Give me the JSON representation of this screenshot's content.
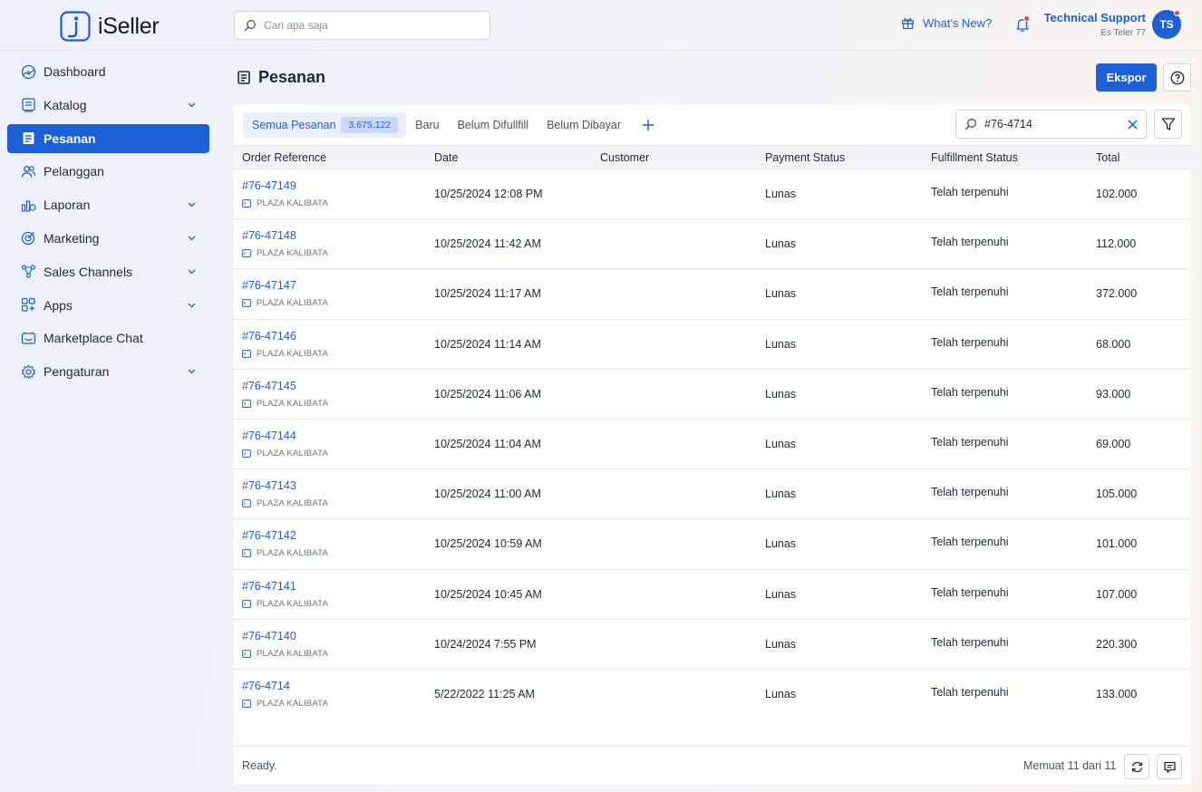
{
  "app": {
    "name": "iSeller"
  },
  "header": {
    "search_placeholder": "Cari apa saja",
    "whats_new": "What's New?",
    "user_name": "Technical Support",
    "user_store": "Es Teler 77",
    "avatar_initials": "TS"
  },
  "sidebar": {
    "items": [
      {
        "label": "Dashboard",
        "icon": "dashboard-icon",
        "has_children": false
      },
      {
        "label": "Katalog",
        "icon": "catalog-icon",
        "has_children": true
      },
      {
        "label": "Pesanan",
        "icon": "orders-icon",
        "has_children": false,
        "active": true
      },
      {
        "label": "Pelanggan",
        "icon": "customers-icon",
        "has_children": false
      },
      {
        "label": "Laporan",
        "icon": "reports-icon",
        "has_children": true
      },
      {
        "label": "Marketing",
        "icon": "target-icon",
        "has_children": true
      },
      {
        "label": "Sales Channels",
        "icon": "channels-icon",
        "has_children": true
      },
      {
        "label": "Apps",
        "icon": "apps-icon",
        "has_children": true
      },
      {
        "label": "Marketplace Chat",
        "icon": "chat-icon",
        "has_children": false
      },
      {
        "label": "Pengaturan",
        "icon": "gear-icon",
        "has_children": true
      }
    ]
  },
  "page": {
    "title": "Pesanan",
    "export_label": "Ekspor"
  },
  "tabs": [
    {
      "label": "Semua Pesanan",
      "badge": "3.675.122",
      "active": true
    },
    {
      "label": "Baru"
    },
    {
      "label": "Belum Difullfill"
    },
    {
      "label": "Belum Dibayar"
    }
  ],
  "order_search": {
    "value": "#76-4714"
  },
  "table": {
    "columns": [
      "Order Reference",
      "Date",
      "Customer",
      "Payment Status",
      "Fulfillment Status",
      "Total"
    ],
    "rows": [
      {
        "ref": "#76-47149",
        "store": "PLAZA KALIBATA",
        "date": "10/25/2024 12:08 PM",
        "customer": "",
        "payment": "Lunas",
        "fulfillment": "Telah terpenuhi",
        "total": "102.000"
      },
      {
        "ref": "#76-47148",
        "store": "PLAZA KALIBATA",
        "date": "10/25/2024 11:42 AM",
        "customer": "",
        "payment": "Lunas",
        "fulfillment": "Telah terpenuhi",
        "total": "112.000"
      },
      {
        "ref": "#76-47147",
        "store": "PLAZA KALIBATA",
        "date": "10/25/2024 11:17 AM",
        "customer": "",
        "payment": "Lunas",
        "fulfillment": "Telah terpenuhi",
        "total": "372.000"
      },
      {
        "ref": "#76-47146",
        "store": "PLAZA KALIBATA",
        "date": "10/25/2024 11:14 AM",
        "customer": "",
        "payment": "Lunas",
        "fulfillment": "Telah terpenuhi",
        "total": "68.000"
      },
      {
        "ref": "#76-47145",
        "store": "PLAZA KALIBATA",
        "date": "10/25/2024 11:06 AM",
        "customer": "",
        "payment": "Lunas",
        "fulfillment": "Telah terpenuhi",
        "total": "93.000"
      },
      {
        "ref": "#76-47144",
        "store": "PLAZA KALIBATA",
        "date": "10/25/2024 11:04 AM",
        "customer": "",
        "payment": "Lunas",
        "fulfillment": "Telah terpenuhi",
        "total": "69.000"
      },
      {
        "ref": "#76-47143",
        "store": "PLAZA KALIBATA",
        "date": "10/25/2024 11:00 AM",
        "customer": "",
        "payment": "Lunas",
        "fulfillment": "Telah terpenuhi",
        "total": "105.000"
      },
      {
        "ref": "#76-47142",
        "store": "PLAZA KALIBATA",
        "date": "10/25/2024 10:59 AM",
        "customer": "",
        "payment": "Lunas",
        "fulfillment": "Telah terpenuhi",
        "total": "101.000"
      },
      {
        "ref": "#76-47141",
        "store": "PLAZA KALIBATA",
        "date": "10/25/2024 10:45 AM",
        "customer": "",
        "payment": "Lunas",
        "fulfillment": "Telah terpenuhi",
        "total": "107.000"
      },
      {
        "ref": "#76-47140",
        "store": "PLAZA KALIBATA",
        "date": "10/24/2024 7:55 PM",
        "customer": "",
        "payment": "Lunas",
        "fulfillment": "Telah terpenuhi",
        "total": "220.300"
      },
      {
        "ref": "#76-4714",
        "store": "PLAZA KALIBATA",
        "date": "5/22/2022 11:25 AM",
        "customer": "",
        "payment": "Lunas",
        "fulfillment": "Telah terpenuhi",
        "total": "133.000"
      }
    ]
  },
  "footer": {
    "status": "Ready.",
    "count": "Memuat 11 dari 11"
  },
  "colors": {
    "accent": "#1d5fd6",
    "notification": "#ef4444"
  }
}
